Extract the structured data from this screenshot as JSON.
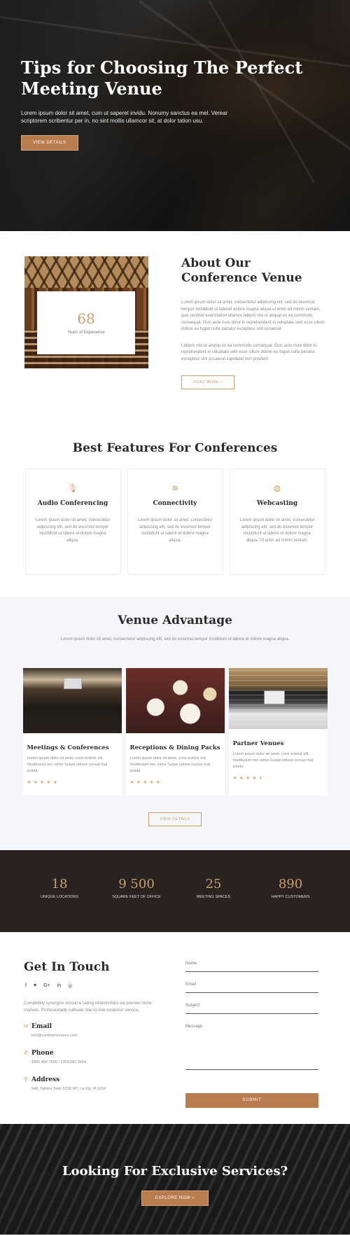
{
  "hero": {
    "title": "Tips for Choosing The Perfect Meeting Venue",
    "text": "Lorem ipsum dolor sit amet, cum ut saperet invidu. Nonumy sanctus ea mel. Verear scriptorem scribentur per in, no sint mollis ullamcor sit, at dolor tation usu.",
    "button": "VIEW DETAILS"
  },
  "about": {
    "stat_value": "68",
    "stat_label": "Years of Experience",
    "title": "About Our Conference Venue",
    "para1": "Lorem ipsum dolor sit amet, consectetur adipiscing elit, sed do eiusmod tempor incididunt ut laboret dolore magna aliqua.ut enim ad minim veniam, quis nostrud exercitation ullamco laboris nisi ut aliquip ex ea commodo consequat. Duis aute irure dolor in reprehenderit in voluptate velit esse cillum dolore eu fugiat nulla pariatur excepteur sint occaecat",
    "para2": "Laboris nisi ut aliquip ex ea commodo consequat. Duis aute irure dolor in reprehenderit in voluptate velit esse cillum dolore eu fugiat nulla pariatur excepteur sint occaecat cupidatat non proident",
    "button": "READ MORE »"
  },
  "features": {
    "title": "Best Features For Conferences",
    "items": [
      {
        "icon": "microphone-icon",
        "glyph": "🎙",
        "title": "Audio Conferencing",
        "text": "Lorem ipsum dolor sit amet, consectetur adipiscing elit, sed do eiusmod tempor incididunt ut labore et dolore magna aliqua."
      },
      {
        "icon": "wifi-icon",
        "glyph": "≋",
        "title": "Connectivity",
        "text": "Lorem ipsum dolor sit amet, consectetur adipiscing elit, sed do eiusmod tempor incididunt ut labore et dolore magna aliqua."
      },
      {
        "icon": "globe-icon",
        "glyph": "◍",
        "title": "Webcasting",
        "text": "Lorem ipsum dolor sit amet, consectetur adipiscing elit, sed do eiusmod tempor incididunt ut labore et dolore magna aliqua. Ut enim ad minim veniam."
      }
    ]
  },
  "advantage": {
    "title": "Venue Advantage",
    "subtitle": "Lorem ipsum dolor sit amet, consectetur adipiscing elit, sed do eiusmod tempor incididunt ut labore et dolore magna aliqua.",
    "cards": [
      {
        "title": "Meetings & Conferences",
        "text": "Lorem ipsum dolor sit amet, cons ectetur elit. Vestibulum nec odios Suspe ndisse cursus mal suada.",
        "stars": "★★★★★",
        "rating": 5
      },
      {
        "title": "Receptions & Dining Packs",
        "text": "Lorem ipsum dolor sit amet, cons ectetur elit. Vestibulum nec odios Suspe ndisse cursus mal suada.",
        "stars": "★★★★★",
        "rating": 5
      },
      {
        "title": "Partner Venues",
        "text": "Lorem ipsum dolor sit amet, cons ectetur elit. Vestibulum nec odios Suspe ndisse cursus mal suada.",
        "stars": "★★★★⯪",
        "rating": 4.5
      }
    ],
    "button": "VIEW DETAILS"
  },
  "stats": [
    {
      "value": "18",
      "label": "UNIQUE LOCATIONS"
    },
    {
      "value": "9 500",
      "label": "SQUARE FEET OF OFFICE"
    },
    {
      "value": "25",
      "label": "MEETING SPACES"
    },
    {
      "value": "890",
      "label": "HAPPY CUSTOMERS"
    }
  ],
  "contact": {
    "title": "Get In Touch",
    "socials": [
      "f",
      "♥",
      "G+",
      "in",
      "◎"
    ],
    "intro": "Completely synergize resource taxing relationships via premier niche markets. Professionally cultivate one-to-one customer service.",
    "email_label": "Email",
    "email_value": "info@conferencevenu.com",
    "phone_label": "Phone",
    "phone_value": "1800 456 7890 / 1254 897 3654",
    "address_label": "Address",
    "address_value": "548, Tailstoi Town 5238 MT, La city, IA 5224",
    "form": {
      "name": "Name",
      "email": "Email",
      "subject": "Subject",
      "message": "Message",
      "submit": "SUBMIT"
    }
  },
  "cta": {
    "title": "Looking For Exclusive Services?",
    "button": "EXPLORE NOW »"
  }
}
